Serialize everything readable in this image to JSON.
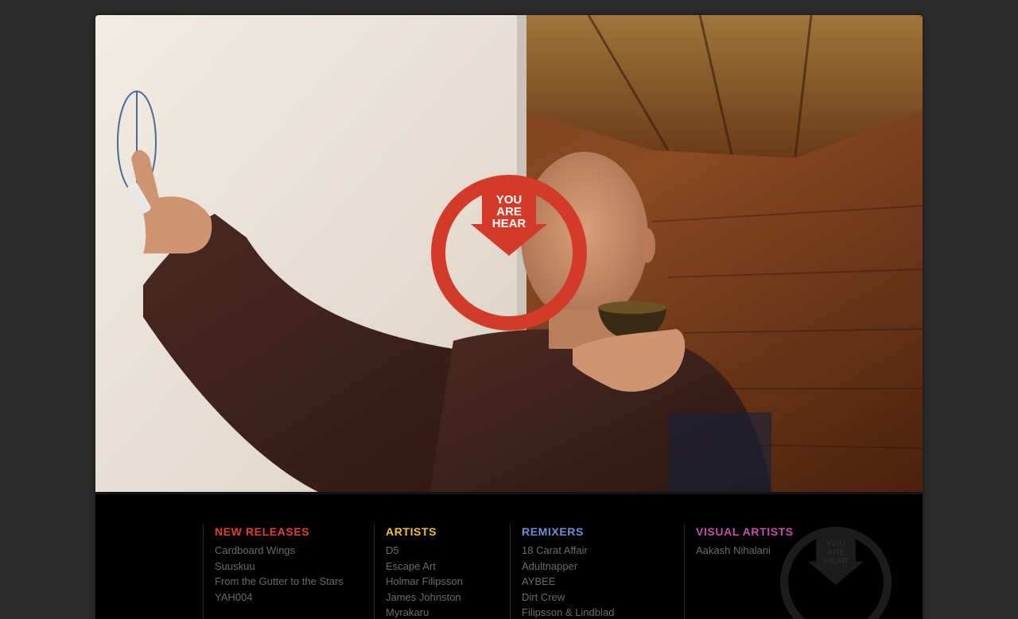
{
  "hero": {
    "logo_text": [
      "YOU",
      "ARE",
      "HEAR"
    ],
    "logo_color": "#d23a2a"
  },
  "nav": [
    {
      "heading": "NEW RELEASES",
      "color": "#e0402e",
      "items": [
        "Cardboard Wings",
        "Suuskuu",
        "From the Gutter to the Stars",
        "YAH004"
      ]
    },
    {
      "heading": "ARTISTS",
      "color": "#f2c22a",
      "items": [
        "D5",
        "Escape Art",
        "Holmar Filipsson",
        "James Johnston",
        "Myrakaru"
      ]
    },
    {
      "heading": "REMIXERS",
      "color": "#6e8fd6",
      "items": [
        "18 Carat Affair",
        "Adultnapper",
        "AYBEE",
        "Dirt Crew",
        "Filipsson & Lindblad"
      ]
    },
    {
      "heading": "VISUAL ARTISTS",
      "color": "#c24fae",
      "items": [
        "Aakash Nihalani"
      ]
    }
  ],
  "footer_logo": {
    "text": [
      "YOU",
      "ARE",
      "HEAR"
    ],
    "color": "#1c1c1c"
  }
}
